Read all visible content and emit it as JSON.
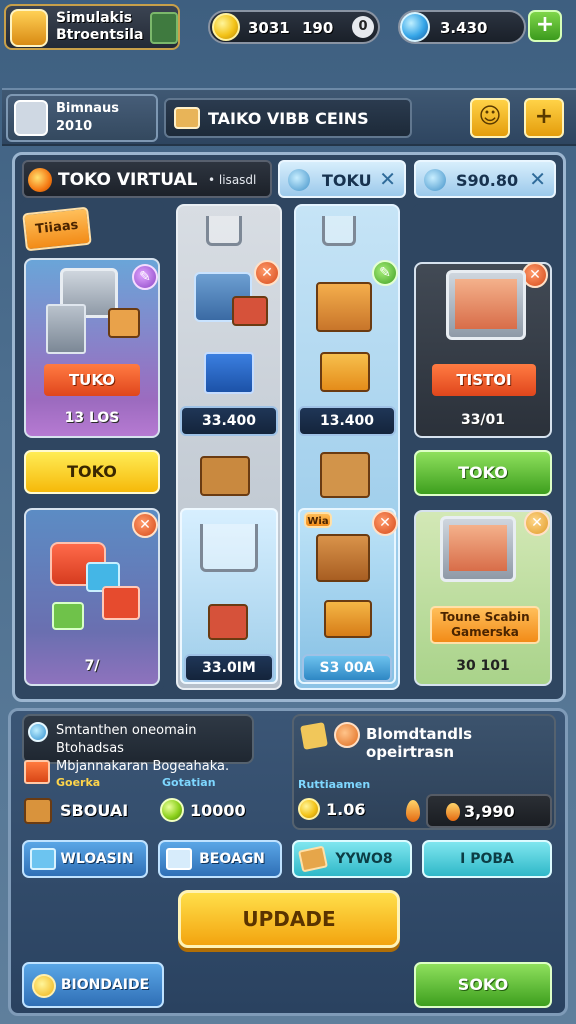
{
  "topbar": {
    "title_line1": "Simulakis",
    "title_line2": "Btroentsila",
    "coins_value": "3031",
    "coins_value2": "190",
    "coins_zero": "0",
    "gems_value": "3.430",
    "plus": "+"
  },
  "storebar": {
    "avatar_line1": "Bimnaus",
    "avatar_line2": "2010",
    "tab_title": "TAIKO VIBB CEINS",
    "plus": "+"
  },
  "header": {
    "title": "TOKO VIRTUAL",
    "subtitle": "• lisasdl",
    "tab1": "TOKU",
    "tab2": "S90.80",
    "close": "✕"
  },
  "col1": {
    "tag": "Tiiaas",
    "ribbon": "TUKO",
    "price": "13 LOS",
    "button": "TOKO",
    "bottom_price": "7/",
    "badge": "✕"
  },
  "col2": {
    "price_top": "33.400",
    "price_bottom": "33.0IM"
  },
  "col3": {
    "price_top": "13.400",
    "price_bottom": "S3 00A",
    "tag": "Wia"
  },
  "col4": {
    "ribbon": "TISTOI",
    "price": "33/01",
    "button": "TOKO",
    "tag_line1": "Toune Scabin",
    "tag_line2": "Gamerska",
    "bottom_price": "30 101"
  },
  "bottom": {
    "info_line1": "Smtanthen oneomain Btohadsas",
    "info_line2": "Mbjannakaran Bogeahaka.",
    "right_title": "Blomdtandls opeirtrasn",
    "lbl_left1": "Goerka",
    "lbl_left2": "Gotatian",
    "val_left1": "SBOUAI",
    "val_left2": "10000",
    "lbl_right1": "Ruttiaamen",
    "val_right1": "1.06",
    "val_right2": "3,990",
    "btn1": "WLOASIN",
    "btn2": "BEOAGN",
    "btn3": "YYWO8",
    "btn4": "I POBA",
    "update": "UPDADE",
    "btn_bottom_left": "BIONDAIDE",
    "btn_bottom_right": "SOKO"
  }
}
